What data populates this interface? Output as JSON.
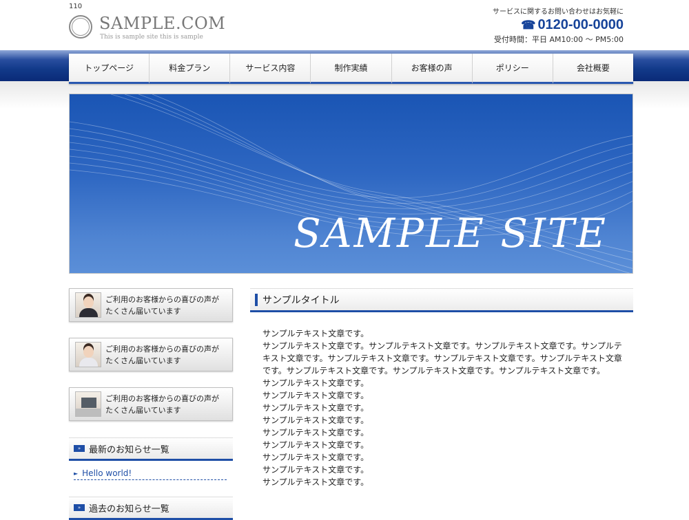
{
  "header": {
    "page_number": "110",
    "logo_name": "SAMPLE.COM",
    "logo_tagline": "This is sample site this is sample",
    "contact_lead": "サービスに関するお問い合わせはお気軽に",
    "phone": "0120-00-0000",
    "hours": "受付時間：平日 AM10:00 ～ PM5:00"
  },
  "nav": {
    "items": [
      "トップページ",
      "料金プラン",
      "サービス内容",
      "制作実績",
      "お客様の声",
      "ポリシー",
      "会社概要"
    ]
  },
  "hero": {
    "title": "SAMPLE SITE"
  },
  "sidebar": {
    "banners": [
      {
        "line1": "ご利用のお客様からの喜びの声が",
        "line2": "たくさん届いています"
      },
      {
        "line1": "ご利用のお客様からの喜びの声が",
        "line2": "たくさん届いています"
      },
      {
        "line1": "ご利用のお客様からの喜びの声が",
        "line2": "たくさん届いています"
      }
    ],
    "news_heading": "最新のお知らせ一覧",
    "news_items": [
      "Hello world!"
    ],
    "archive_heading": "過去のお知らせ一覧"
  },
  "main": {
    "title": "サンプルタイトル",
    "paragraphs": [
      "サンプルテキスト文章です。",
      "サンプルテキスト文章です。サンプルテキスト文章です。サンプルテキスト文章です。サンプルテキスト文章です。サンプルテキスト文章です。サンプルテキスト文章です。サンプルテキスト文章です。サンプルテキスト文章です。サンプルテキスト文章です。サンプルテキスト文章です。",
      "サンプルテキスト文章です。",
      "サンプルテキスト文章です。",
      "サンプルテキスト文章です。",
      "サンプルテキスト文章です。",
      "サンプルテキスト文章です。",
      "サンプルテキスト文章です。",
      "サンプルテキスト文章です。",
      "サンプルテキスト文章です。",
      "サンプルテキスト文章です。"
    ]
  },
  "colors": {
    "accent": "#1e4ea6",
    "phone": "#17449a"
  },
  "icons": {
    "phone": "phone-icon",
    "logo_stamp": "stamp-of-approval-icon",
    "news_arrow": "triangle-right-icon",
    "heading_mark": "double-chevron-icon"
  }
}
